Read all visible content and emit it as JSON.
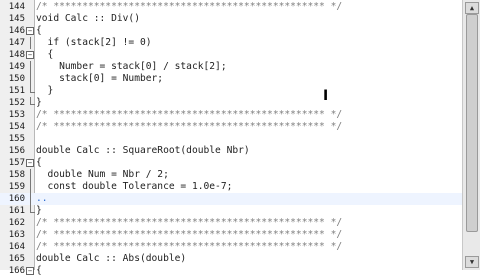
{
  "editor": {
    "lines": [
      {
        "num": "144",
        "fold": "none",
        "text": "/* *********************************************** */",
        "style": "comment"
      },
      {
        "num": "145",
        "fold": "none",
        "text": "void Calc :: Div()",
        "style": "code"
      },
      {
        "num": "146",
        "fold": "box",
        "text": "{",
        "style": "code"
      },
      {
        "num": "147",
        "fold": "vline",
        "text": "  if (stack[2] != 0)",
        "style": "code"
      },
      {
        "num": "148",
        "fold": "box",
        "text": "  {",
        "style": "code"
      },
      {
        "num": "149",
        "fold": "vline",
        "text": "    Number = stack[0] / stack[2];",
        "style": "code"
      },
      {
        "num": "150",
        "fold": "vline",
        "text": "    stack[0] = Number;",
        "style": "code"
      },
      {
        "num": "151",
        "fold": "corner",
        "text": "  }",
        "style": "code"
      },
      {
        "num": "152",
        "fold": "corner",
        "text": "}",
        "style": "code"
      },
      {
        "num": "153",
        "fold": "none",
        "text": "/* *********************************************** */",
        "style": "comment"
      },
      {
        "num": "154",
        "fold": "none",
        "text": "/* *********************************************** */",
        "style": "comment"
      },
      {
        "num": "155",
        "fold": "none",
        "text": "",
        "style": "code"
      },
      {
        "num": "156",
        "fold": "none",
        "text": "double Calc :: SquareRoot(double Nbr)",
        "style": "code"
      },
      {
        "num": "157",
        "fold": "box",
        "text": "{",
        "style": "code"
      },
      {
        "num": "158",
        "fold": "vline",
        "text": "  double Num = Nbr / 2;",
        "style": "code"
      },
      {
        "num": "159",
        "fold": "vline",
        "text": "  const double Tolerance = 1.0e-7;",
        "style": "code"
      },
      {
        "num": "160",
        "fold": "vline",
        "text": "",
        "style": "current"
      },
      {
        "num": "161",
        "fold": "corner",
        "text": "}",
        "style": "code"
      },
      {
        "num": "162",
        "fold": "none",
        "text": "/* *********************************************** */",
        "style": "comment"
      },
      {
        "num": "163",
        "fold": "none",
        "text": "/* *********************************************** */",
        "style": "comment"
      },
      {
        "num": "164",
        "fold": "none",
        "text": "/* *********************************************** */",
        "style": "comment"
      },
      {
        "num": "165",
        "fold": "none",
        "text": "double Calc :: Abs(double)",
        "style": "code"
      },
      {
        "num": "166",
        "fold": "box",
        "text": "{",
        "style": "code"
      }
    ]
  },
  "scrollbar": {
    "up_glyph": "▲",
    "down_glyph": "▼"
  },
  "cursor": {
    "glyph": "I"
  },
  "colors": {
    "background": "#ffffff",
    "gutter": "#efefef",
    "comment": "#7f7f7f",
    "current_line": "#eef4ff"
  }
}
